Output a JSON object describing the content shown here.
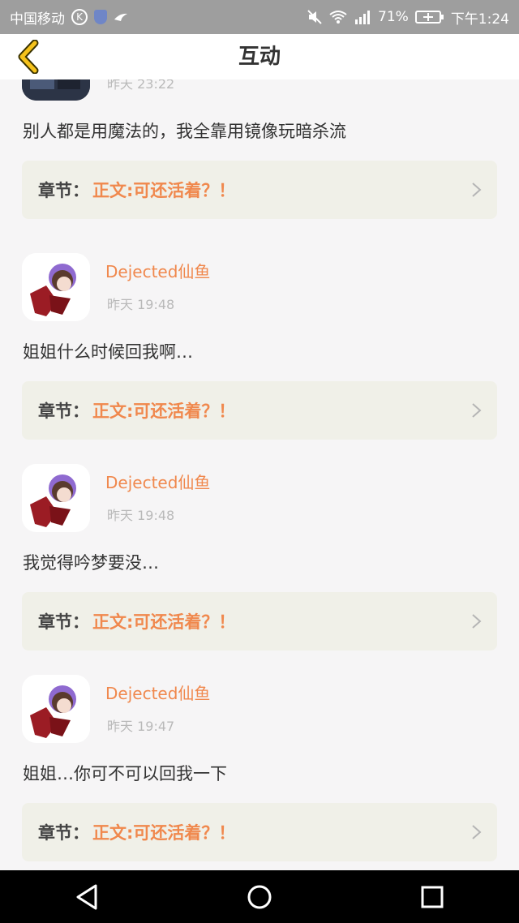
{
  "status_bar": {
    "carrier": "中国移动",
    "k_badge": "K",
    "battery_percent": "71%",
    "time": "下午1:24"
  },
  "header": {
    "title": "互动",
    "back_icon": "chevron-left-icon"
  },
  "chapter_prefix": "章节：",
  "items": [
    {
      "username": "",
      "time": "昨天 23:22",
      "comment": "别人都是用魔法的，我全靠用镜像玩暗杀流",
      "chapter": "正文:可还活着？！"
    },
    {
      "username": "Dejected仙鱼",
      "time": "昨天 19:48",
      "comment": "姐姐什么时候回我啊…",
      "chapter": "正文:可还活着？！"
    },
    {
      "username": "Dejected仙鱼",
      "time": "昨天 19:48",
      "comment": "我觉得吟梦要没…",
      "chapter": "正文:可还活着？！"
    },
    {
      "username": "Dejected仙鱼",
      "time": "昨天 19:47",
      "comment": "姐姐…你可不可以回我一下",
      "chapter": "正文:可还活着？！"
    }
  ],
  "colors": {
    "accent": "#f0884d",
    "back_arrow": "#f5c21b",
    "chapter_bg": "#f0f0e8"
  }
}
